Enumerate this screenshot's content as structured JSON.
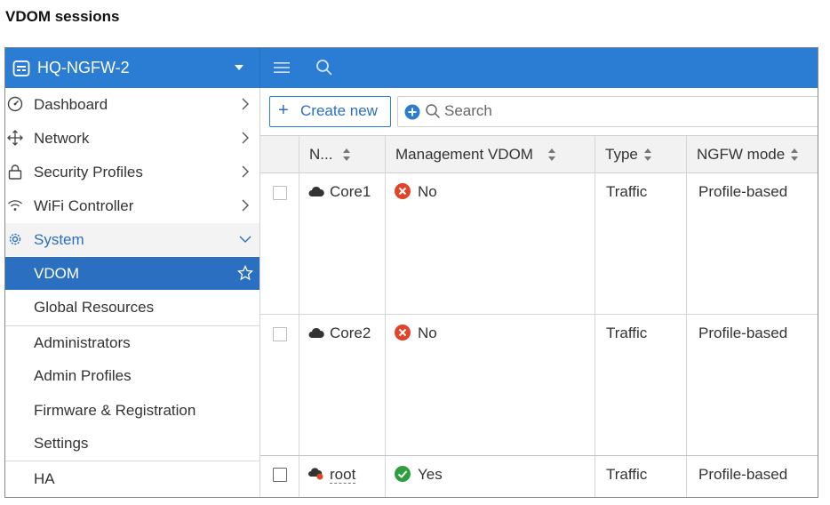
{
  "page": {
    "title": "VDOM sessions"
  },
  "topbar": {
    "device_name": "HQ-NGFW-2",
    "icons": [
      "device-icon",
      "chevron-down-icon",
      "hamburger-icon",
      "search-icon"
    ],
    "color": "#2b7cd3"
  },
  "sidebar": {
    "items": [
      {
        "label": "Dashboard",
        "icon": "dashboard-icon",
        "has_chevron": true
      },
      {
        "label": "Network",
        "icon": "network-icon",
        "has_chevron": true
      },
      {
        "label": "Security Profiles",
        "icon": "lock-icon",
        "has_chevron": true
      },
      {
        "label": "WiFi Controller",
        "icon": "wifi-icon",
        "has_chevron": true
      },
      {
        "label": "System",
        "icon": "gear-icon",
        "expanded": true
      }
    ],
    "system_children": [
      {
        "label": "VDOM",
        "active": true,
        "icon": "star-outline-icon"
      },
      {
        "label": "Global Resources"
      },
      {
        "label": "Administrators"
      },
      {
        "label": "Admin Profiles"
      },
      {
        "label": "Firmware & Registration"
      },
      {
        "label": "Settings"
      },
      {
        "label": "HA"
      }
    ],
    "active_color": "#2b6fc0"
  },
  "toolbar": {
    "create_label": "Create new",
    "search_placeholder": "Search"
  },
  "table": {
    "columns": [
      "N...",
      "Management VDOM",
      "Type",
      "NGFW mode"
    ],
    "rows": [
      {
        "name": "Core1",
        "management": "No",
        "management_status": "error",
        "type": "Traffic",
        "mode": "Profile-based"
      },
      {
        "name": "Core2",
        "management": "No",
        "management_status": "error",
        "type": "Traffic",
        "mode": "Profile-based"
      },
      {
        "name": "root",
        "management": "Yes",
        "management_status": "ok",
        "type": "Traffic",
        "mode": "Profile-based"
      }
    ],
    "status_colors": {
      "error": "#e0452a",
      "ok": "#2e9e3e"
    }
  }
}
